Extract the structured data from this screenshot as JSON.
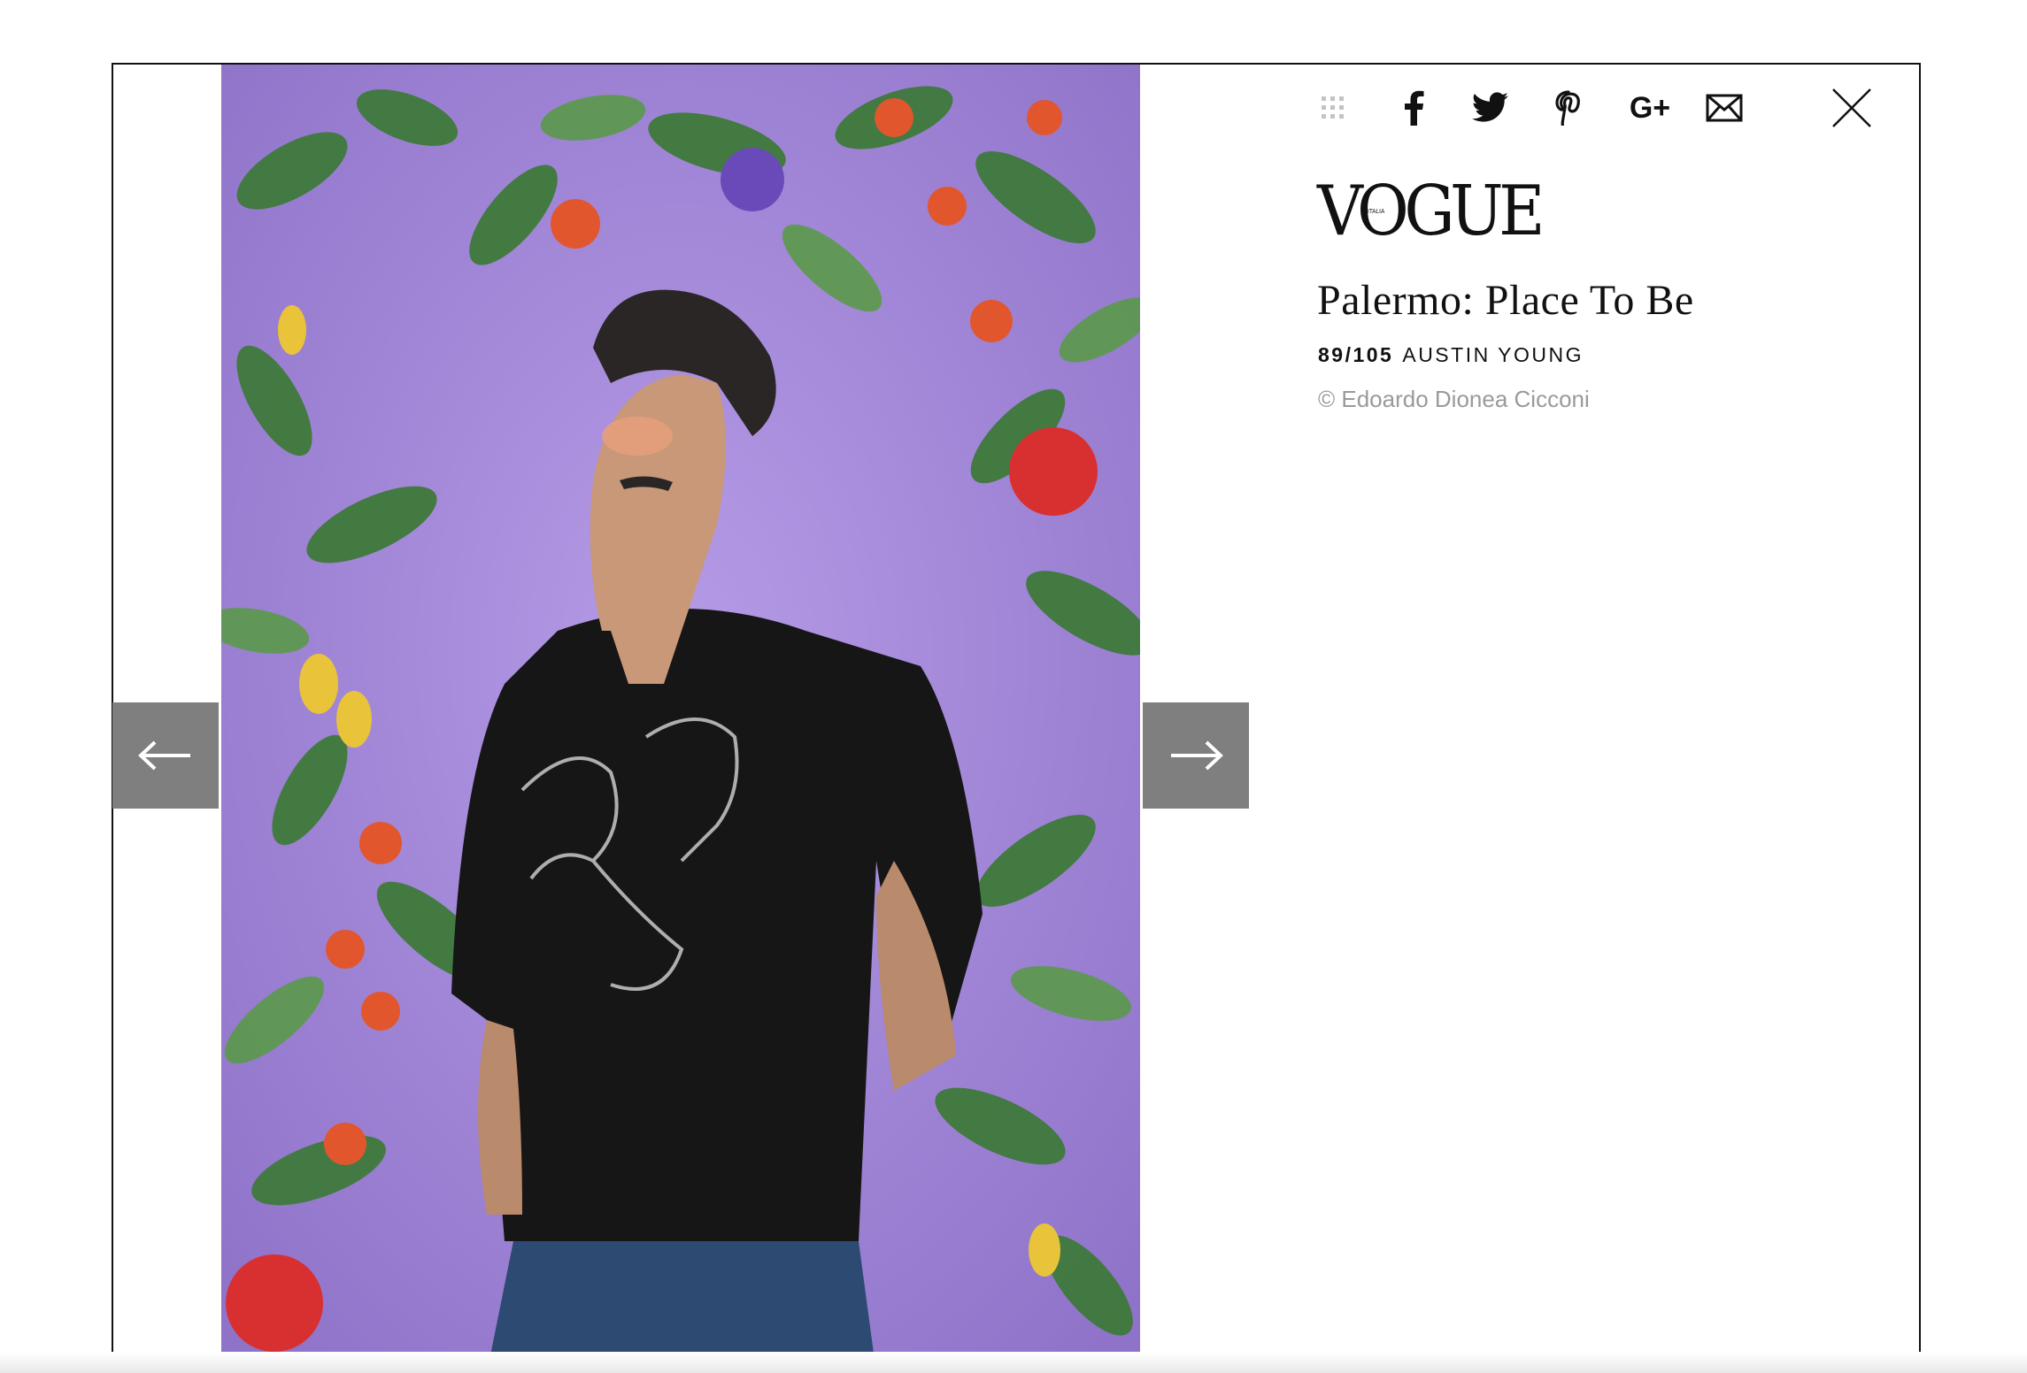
{
  "toolbar": {
    "icons": [
      "grid-icon",
      "facebook-icon",
      "twitter-icon",
      "pinterest-icon",
      "google-plus-icon",
      "email-icon",
      "close-icon"
    ],
    "google_plus_label": "G+"
  },
  "brand": {
    "logo_text": "VOGUE",
    "logo_small": "ITALIA"
  },
  "gallery": {
    "title": "Palermo: Place To Be",
    "counter": "89/105",
    "caption": "AUSTIN YOUNG",
    "credit": "© Edoardo Dionea Cicconi"
  },
  "navigation": {
    "prev_icon": "arrow-left-icon",
    "next_icon": "arrow-right-icon"
  },
  "colors": {
    "nav_button_bg": "#7f7f7f",
    "photo_bg": "#a48ad8",
    "credit_text": "#9a9a9a"
  }
}
